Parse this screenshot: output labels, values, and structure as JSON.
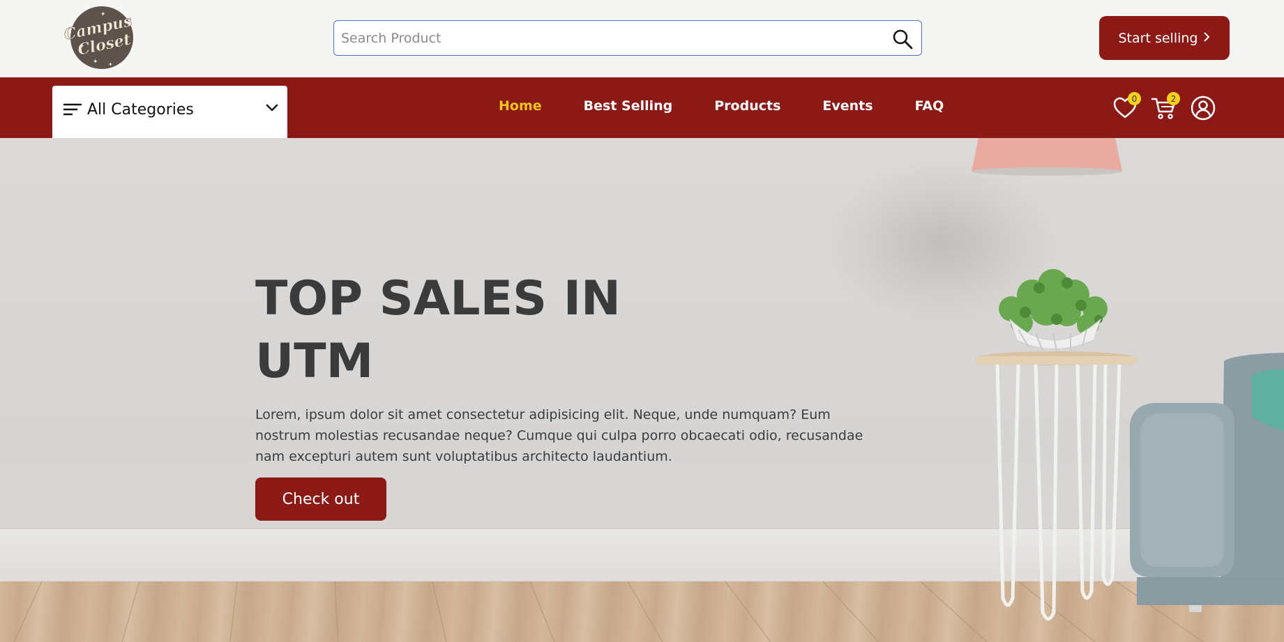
{
  "header": {
    "logo_text_line1": "Campus",
    "logo_text_line2": "Closet",
    "search_placeholder": "Search Product",
    "search_value": "",
    "start_selling_label": "Start selling",
    "start_selling_icon": "chevron-right-icon"
  },
  "navbar": {
    "categories_label": "All Categories",
    "links": [
      {
        "label": "Home",
        "active": true
      },
      {
        "label": "Best Selling",
        "active": false
      },
      {
        "label": "Products",
        "active": false
      },
      {
        "label": "Events",
        "active": false
      },
      {
        "label": "FAQ",
        "active": false
      }
    ],
    "wishlist_count": "0",
    "cart_count": "2"
  },
  "hero": {
    "title_line1": "TOP SALES IN",
    "title_line2": "UTM",
    "description": "Lorem, ipsum dolor sit amet consectetur adipisicing elit. Neque, unde numquam? Eum nostrum molestias recusandae neque? Cumque qui culpa porro obcaecati odio, recusandae nam excepturi autem sunt voluptatibus architecto laudantium.",
    "cta_label": "Check out"
  },
  "colors": {
    "brand": "#8b1a16",
    "active_link": "#f5c518",
    "badge": "#f7d117",
    "search_border": "#4a6fd6"
  }
}
